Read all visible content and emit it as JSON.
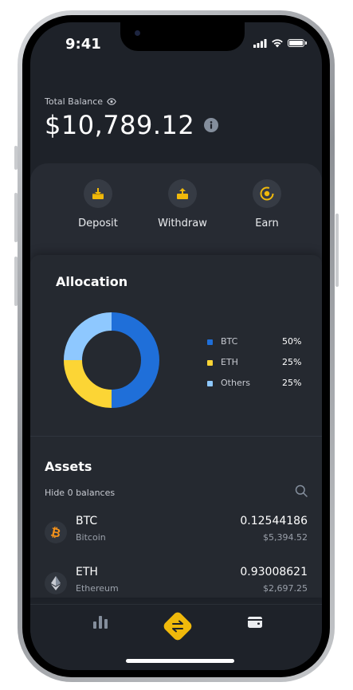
{
  "status_bar": {
    "time": "9:41"
  },
  "balance": {
    "label": "Total Balance",
    "value": "$10,789.12"
  },
  "actions": [
    {
      "label": "Deposit",
      "icon": "deposit-icon"
    },
    {
      "label": "Withdraw",
      "icon": "withdraw-icon"
    },
    {
      "label": "Earn",
      "icon": "earn-icon"
    }
  ],
  "allocation": {
    "title": "Allocation",
    "items": [
      {
        "name": "BTC",
        "percent": "50%",
        "color": "#1f6fd9"
      },
      {
        "name": "ETH",
        "percent": "25%",
        "color": "#fcd535"
      },
      {
        "name": "Others",
        "percent": "25%",
        "color": "#8ec8ff"
      }
    ]
  },
  "chart_data": {
    "type": "pie",
    "categories": [
      "BTC",
      "ETH",
      "Others"
    ],
    "values": [
      50,
      25,
      25
    ],
    "title": "Allocation",
    "colors": [
      "#1f6fd9",
      "#fcd535",
      "#8ec8ff"
    ]
  },
  "assets": {
    "title": "Assets",
    "hide_zero_label": "Hide 0 balances",
    "items": [
      {
        "symbol": "BTC",
        "name": "Bitcoin",
        "amount": "0.12544186",
        "fiat": "$5,394.52",
        "icon": "bitcoin-icon"
      },
      {
        "symbol": "ETH",
        "name": "Ethereum",
        "amount": "0.93008621",
        "fiat": "$2,697.25",
        "icon": "ethereum-icon"
      }
    ]
  },
  "bottom_nav": {
    "items": [
      {
        "name": "markets",
        "icon": "bar-chart-icon"
      },
      {
        "name": "trade",
        "icon": "swap-arrows-icon"
      },
      {
        "name": "wallet",
        "icon": "wallet-icon"
      }
    ],
    "accent": "#f0b90b"
  },
  "colors": {
    "background": "#1e2229",
    "card": "#272b33",
    "accent": "#f0b90b"
  }
}
